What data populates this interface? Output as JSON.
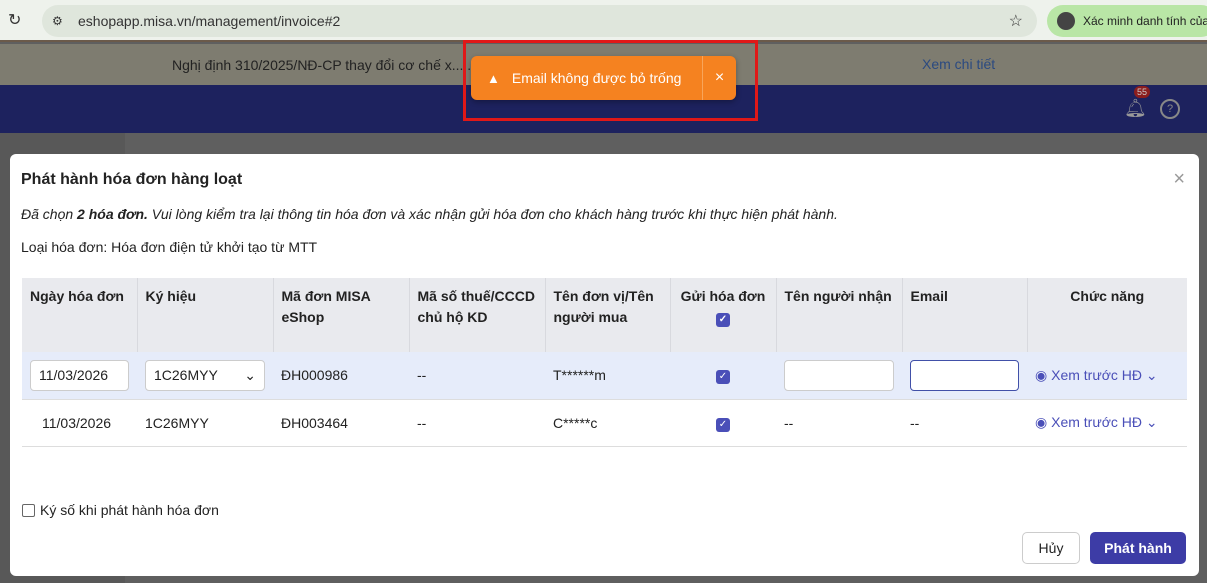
{
  "browser": {
    "url": "eshopapp.misa.vn/management/invoice#2",
    "profile": "Xác minh danh tính của"
  },
  "banner": {
    "text": "Nghị định 310/2025/NĐ-CP thay đổi cơ chế x... ...ời điểm, không lập hóa đơn",
    "link": "Xem chi tiết"
  },
  "header": {
    "notifications": "55"
  },
  "toast": {
    "message": "Email không được bỏ trống",
    "close": "×"
  },
  "modal": {
    "title": "Phát hành hóa đơn hàng loạt",
    "desc_prefix": "Đã chọn ",
    "desc_bold": "2 hóa đơn.",
    "desc_rest": " Vui lòng kiểm tra lại thông tin hóa đơn và xác nhận gửi hóa đơn cho khách hàng trước khi thực hiện phát hành.",
    "invoice_type": "Loại hóa đơn: Hóa đơn điện tử khởi tạo từ MTT",
    "columns": [
      "Ngày hóa đơn",
      "Ký hiệu",
      "Mã đơn MISA eShop",
      "Mã số thuế/CCCD chủ hộ KD",
      "Tên đơn vị/Tên người mua",
      "Gửi hóa đơn",
      "Tên người nhận",
      "Email",
      "Chức năng"
    ],
    "rows": [
      {
        "date": "11/03/2026",
        "symbol": "1C26MYY",
        "order": "ĐH000986",
        "tax": "--",
        "buyer": "T******m",
        "receiver": "",
        "email": "",
        "action": "Xem trước HĐ"
      },
      {
        "date": "11/03/2026",
        "symbol": "1C26MYY",
        "order": "ĐH003464",
        "tax": "--",
        "buyer": "C*****c",
        "receiver": "--",
        "email": "--",
        "action": "Xem trước HĐ"
      }
    ],
    "sign_label": "Ký số khi phát hành hóa đơn",
    "cancel": "Hủy",
    "issue": "Phát hành"
  }
}
